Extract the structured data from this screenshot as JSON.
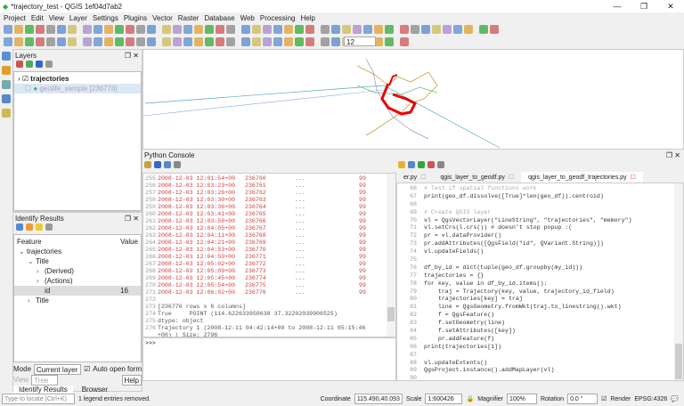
{
  "window": {
    "title": "*trajectory_test - QGIS 1ef04d7ab2",
    "min": "—",
    "max": "❐",
    "close": "✕"
  },
  "menu": [
    "Project",
    "Edit",
    "View",
    "Layer",
    "Settings",
    "Plugins",
    "Vector",
    "Raster",
    "Database",
    "Web",
    "Processing",
    "Help"
  ],
  "toolbar": {
    "font_size": "12"
  },
  "layers": {
    "title": "Layers",
    "items": [
      {
        "name": "trajectories",
        "checked": true
      },
      {
        "name": "geolife_sample [236776]",
        "checked": false
      }
    ]
  },
  "identify": {
    "title": "Identify Results",
    "col_feature": "Feature",
    "col_value": "Value",
    "rows": [
      {
        "label": "trajectories",
        "indent": 0,
        "arrow": "v"
      },
      {
        "label": "Title",
        "indent": 1,
        "arrow": "v"
      },
      {
        "label": "(Derived)",
        "indent": 2,
        "arrow": ">"
      },
      {
        "label": "(Actions)",
        "indent": 2,
        "arrow": ">"
      },
      {
        "label": "id",
        "indent": 2,
        "arrow": "",
        "value": "16"
      },
      {
        "label": "Title",
        "indent": 1,
        "arrow": ">"
      }
    ],
    "mode_label": "Mode",
    "mode_value": "Current layer",
    "auto_open": "Auto open form",
    "view_label": "View",
    "view_value": "Tree",
    "help": "Help",
    "tabs": [
      "Identify Results",
      "Browser"
    ]
  },
  "console": {
    "title": "Python Console",
    "output": [
      [
        "255",
        "2008-12-03 12:01:54+00",
        "236760"
      ],
      [
        "256",
        "2008-12-03 12:03:23+00",
        "236761"
      ],
      [
        "257",
        "2008-12-03 12:03:26+00",
        "236762"
      ],
      [
        "258",
        "2008-12-03 12:03:30+00",
        "236763"
      ],
      [
        "259",
        "2008-12-03 12:03:36+00",
        "236764"
      ],
      [
        "260",
        "2008-12-03 12:03:41+00",
        "236765"
      ],
      [
        "261",
        "2008-12-03 12:03:50+00",
        "236766"
      ],
      [
        "262",
        "2008-12-03 12:04:05+00",
        "236767"
      ],
      [
        "263",
        "2008-12-03 12:04:11+00",
        "236768"
      ],
      [
        "264",
        "2008-12-03 12:04:21+00",
        "236769"
      ],
      [
        "265",
        "2008-12-03 12:04:53+00",
        "236770"
      ],
      [
        "266",
        "2008-12-03 12:04:59+00",
        "236771"
      ],
      [
        "267",
        "2008-12-03 12:05:02+00",
        "236772"
      ],
      [
        "268",
        "2008-12-03 12:05:09+00",
        "236773"
      ],
      [
        "269",
        "2008-12-03 12:05:45+00",
        "236774"
      ],
      [
        "270",
        "2008-12-03 12:05:54+00",
        "236775"
      ],
      [
        "271",
        "2008-12-03 12:06:02+00",
        "236776"
      ]
    ],
    "ellipsis": "...",
    "col99": "99",
    "tail": [
      [
        "272",
        ""
      ],
      [
        "273",
        "[236776 rows x 6 columns]"
      ],
      [
        "274",
        "True     POINT (114.622633950638 37.32202039906525)"
      ],
      [
        "275",
        "dtype: object"
      ],
      [
        "276",
        "Trajectory 1 (2008-12-11 04:42:14+00 to 2008-12-11 05:15:46"
      ],
      [
        "",
        "+00) | Size: 2796"
      ],
      [
        "277",
        ""
      ]
    ],
    "prompt": ">>>"
  },
  "editor": {
    "tabs": [
      "er.py",
      "qgis_layer_to_geodf.py",
      "qgis_layer_to_geodf_trajectories.py"
    ],
    "lines": [
      [
        "66",
        "# Test if spatial functions work",
        "cm"
      ],
      [
        "67",
        "print(geo_df.dissolve([True]*len(geo_df)).centroid)",
        ""
      ],
      [
        "68",
        "",
        ""
      ],
      [
        "69",
        "# Create QGIS layer",
        "cm"
      ],
      [
        "70",
        "vl = QgsVectorLayer(\"LineString\", \"trajectories\", \"memory\")",
        ""
      ],
      [
        "71",
        "vl.setCrs(l.crs()) # doesn't stop popup :(",
        ""
      ],
      [
        "72",
        "pr = vl.dataProvider()",
        ""
      ],
      [
        "73",
        "pr.addAttributes([QgsField(\"id\", QVariant.String)])",
        ""
      ],
      [
        "74",
        "vl.updateFields()",
        ""
      ],
      [
        "75",
        "",
        ""
      ],
      [
        "76",
        "df_by_id = dict(tuple(geo_df.groupby(my_id)))",
        ""
      ],
      [
        "77",
        "trajectories = {}",
        ""
      ],
      [
        "78",
        "for key, value in df_by_id.items():",
        ""
      ],
      [
        "79",
        "    traj = Trajectory(key, value, trajectory_id_field)",
        ""
      ],
      [
        "80",
        "    trajectories[key] = traj",
        ""
      ],
      [
        "81",
        "    line = QgsGeometry.fromWkt(traj.to_linestring().wkt)",
        ""
      ],
      [
        "82",
        "    f = QgsFeature()",
        ""
      ],
      [
        "83",
        "    f.setGeometry(line)",
        ""
      ],
      [
        "84",
        "    f.setAttributes([key])",
        ""
      ],
      [
        "85",
        "    pr.addFeature(f)",
        ""
      ],
      [
        "86",
        "print(trajectories[1])",
        ""
      ],
      [
        "87",
        "",
        ""
      ],
      [
        "88",
        "vl.updateExtents()",
        ""
      ],
      [
        "89",
        "QgsProject.instance().addMapLayer(vl)",
        ""
      ],
      [
        "90",
        "",
        ""
      ]
    ]
  },
  "status": {
    "locate_placeholder": "Type to locate (Ctrl+K)",
    "message": "1 legend entries removed.",
    "coord_label": "Coordinate",
    "coord": "115.490,40.093",
    "scale_label": "Scale",
    "scale": "1:600426",
    "magnifier_label": "Magnifier",
    "magnifier": "100%",
    "rotation_label": "Rotation",
    "rotation": "0.0 °",
    "render": "Render",
    "crs": "EPSG:4326"
  }
}
